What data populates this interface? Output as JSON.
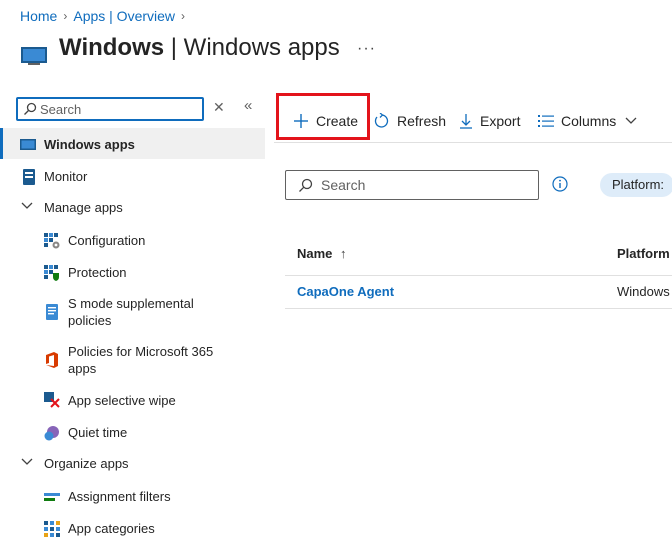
{
  "breadcrumb": {
    "home": "Home",
    "apps_overview": "Apps | Overview"
  },
  "page": {
    "title_bold": "Windows",
    "title_rest": " | Windows apps",
    "more": "···"
  },
  "sidebar": {
    "search_placeholder": "Search",
    "items": [
      {
        "label": "Windows apps"
      },
      {
        "label": "Monitor"
      },
      {
        "label": "Manage apps"
      },
      {
        "label": "Configuration"
      },
      {
        "label": "Protection"
      },
      {
        "label": "S mode supplemental policies"
      },
      {
        "label": "Policies for Microsoft 365 apps"
      },
      {
        "label": "App selective wipe"
      },
      {
        "label": "Quiet time"
      },
      {
        "label": "Organize apps"
      },
      {
        "label": "Assignment filters"
      },
      {
        "label": "App categories"
      }
    ]
  },
  "toolbar": {
    "create": "Create",
    "refresh": "Refresh",
    "export": "Export",
    "columns": "Columns"
  },
  "main": {
    "search_placeholder": "Search",
    "filter_pill": "Platform:",
    "table": {
      "headers": {
        "name": "Name",
        "sort_indicator": "↑",
        "platform": "Platform"
      },
      "rows": [
        {
          "name": "CapaOne Agent",
          "platform": "Windows"
        }
      ]
    }
  },
  "colors": {
    "accent": "#0f6cbd",
    "highlight": "#e3131b",
    "active_bg": "#f0f0f0",
    "pill_bg": "#deecf9"
  }
}
